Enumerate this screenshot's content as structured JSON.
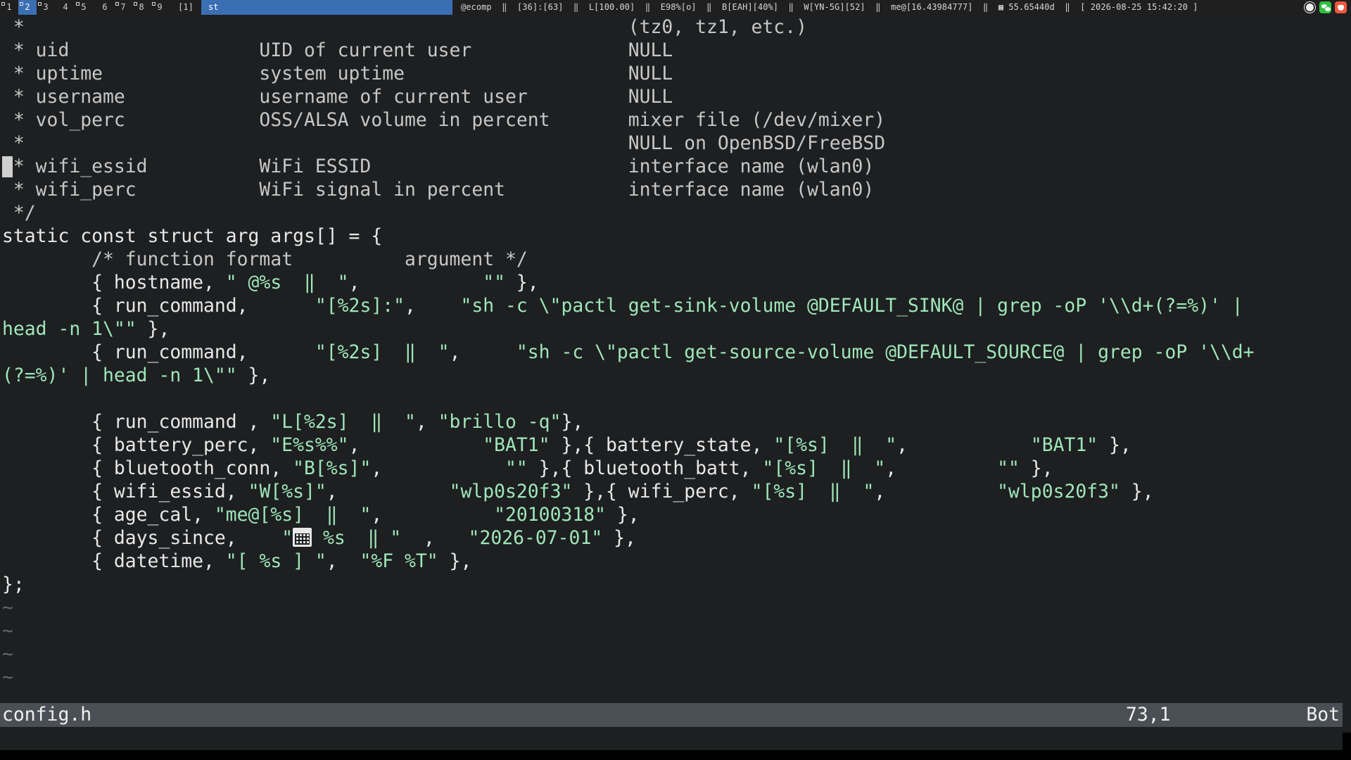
{
  "topbar": {
    "tags": [
      "1",
      "2",
      "3",
      "4",
      "5",
      "6",
      "7",
      "8",
      "9"
    ],
    "selected_tag": "2",
    "layout": "[1]",
    "window_title": "st",
    "status_text": "@ecomp  ‖  [36]:[63]  ‖  L[100.00]  ‖  E98%[o]  ‖  B[EAH][40%]  ‖  W[YN-5G][52]  ‖  me@[16.43984777]  ‖  ▦ 55.65440d  ‖  [ 2026-08-25 15:42:20 ]",
    "tray_icons": [
      "brightness-icon",
      "wechat-icon",
      "app-icon"
    ]
  },
  "editor": {
    "lines": [
      [
        {
          "t": " *                                                      (tz0, tz1, etc.)",
          "c": "com"
        }
      ],
      [
        {
          "t": " * uid                 UID of current user              NULL",
          "c": "com"
        }
      ],
      [
        {
          "t": " * uptime              system uptime                    NULL",
          "c": "com"
        }
      ],
      [
        {
          "t": " * username            username of current user         NULL",
          "c": "com"
        }
      ],
      [
        {
          "t": " * vol_perc            OSS/ALSA volume in percent       mixer file (/dev/mixer)",
          "c": "com"
        }
      ],
      [
        {
          "t": " *                                                      NULL on OpenBSD/FreeBSD",
          "c": "com"
        }
      ],
      [
        {
          "t": " * wifi_essid          WiFi ESSID                       interface name (wlan0)",
          "c": "com"
        }
      ],
      [
        {
          "t": " * wifi_perc           WiFi signal in percent           interface name (wlan0)",
          "c": "com"
        }
      ],
      [
        {
          "t": " */",
          "c": "com"
        }
      ],
      [
        {
          "t": "static const struct arg args[] = {",
          "c": "n"
        }
      ],
      [
        {
          "t": "        /* function format          argument */",
          "c": "com"
        }
      ],
      [
        {
          "t": "        { hostname, ",
          "c": "n"
        },
        {
          "t": "\" @%s  ‖  \"",
          "c": "str"
        },
        {
          "t": ",           ",
          "c": "n"
        },
        {
          "t": "\"\"",
          "c": "str"
        },
        {
          "t": " },",
          "c": "n"
        }
      ],
      [
        {
          "t": "        { run_command,      ",
          "c": "n"
        },
        {
          "t": "\"[%2s]:\"",
          "c": "str"
        },
        {
          "t": ",    ",
          "c": "n"
        },
        {
          "t": "\"sh -c \\\"pactl get-sink-volume @DEFAULT_SINK@ | grep -oP '\\\\d+(?=%)' |",
          "c": "str"
        }
      ],
      [
        {
          "t": "head -n 1\\\"\"",
          "c": "str"
        },
        {
          "t": " },",
          "c": "n"
        }
      ],
      [
        {
          "t": "        { run_command,      ",
          "c": "n"
        },
        {
          "t": "\"[%2s]  ‖  \"",
          "c": "str"
        },
        {
          "t": ",     ",
          "c": "n"
        },
        {
          "t": "\"sh -c \\\"pactl get-source-volume @DEFAULT_SOURCE@ | grep -oP '\\\\d+",
          "c": "str"
        }
      ],
      [
        {
          "t": "(?=%)' | head -n 1\\\"\"",
          "c": "str"
        },
        {
          "t": " },",
          "c": "n"
        }
      ],
      [
        {
          "t": "",
          "c": "n"
        }
      ],
      [
        {
          "t": "        { run_command , ",
          "c": "n"
        },
        {
          "t": "\"L[%2s]  ‖  \"",
          "c": "str"
        },
        {
          "t": ", ",
          "c": "n"
        },
        {
          "t": "\"brillo -q\"",
          "c": "str"
        },
        {
          "t": "},",
          "c": "n"
        }
      ],
      [
        {
          "t": "        { battery_perc, ",
          "c": "n"
        },
        {
          "t": "\"E%s%%\"",
          "c": "str"
        },
        {
          "t": ",           ",
          "c": "n"
        },
        {
          "t": "\"BAT1\"",
          "c": "str"
        },
        {
          "t": " },{ battery_state, ",
          "c": "n"
        },
        {
          "t": "\"[%s]  ‖  \"",
          "c": "str"
        },
        {
          "t": ",           ",
          "c": "n"
        },
        {
          "t": "\"BAT1\"",
          "c": "str"
        },
        {
          "t": " },",
          "c": "n"
        }
      ],
      [
        {
          "t": "        { bluetooth_conn, ",
          "c": "n"
        },
        {
          "t": "\"B[%s]\"",
          "c": "str"
        },
        {
          "t": ",           ",
          "c": "n"
        },
        {
          "t": "\"\"",
          "c": "str"
        },
        {
          "t": " },{ bluetooth_batt, ",
          "c": "n"
        },
        {
          "t": "\"[%s]  ‖  \"",
          "c": "str"
        },
        {
          "t": ",         ",
          "c": "n"
        },
        {
          "t": "\"\"",
          "c": "str"
        },
        {
          "t": " },",
          "c": "n"
        }
      ],
      [
        {
          "t": "        { wifi_essid, ",
          "c": "n"
        },
        {
          "t": "\"W[%s]\"",
          "c": "str"
        },
        {
          "t": ",          ",
          "c": "n"
        },
        {
          "t": "\"wlp0s20f3\"",
          "c": "str"
        },
        {
          "t": " },{ wifi_perc, ",
          "c": "n"
        },
        {
          "t": "\"[%s]  ‖  \"",
          "c": "str"
        },
        {
          "t": ",          ",
          "c": "n"
        },
        {
          "t": "\"wlp0s20f3\"",
          "c": "str"
        },
        {
          "t": " },",
          "c": "n"
        }
      ],
      [
        {
          "t": "        { age_cal, ",
          "c": "n"
        },
        {
          "t": "\"me@[%s]  ‖  \"",
          "c": "str"
        },
        {
          "t": ",          ",
          "c": "n"
        },
        {
          "t": "\"20100318\"",
          "c": "str"
        },
        {
          "t": " },",
          "c": "n"
        }
      ],
      [
        {
          "t": "        { days_since,    ",
          "c": "n"
        },
        {
          "t": "\"",
          "c": "str"
        },
        {
          "t": "ICON",
          "c": "cal"
        },
        {
          "t": " %s  ‖ \"",
          "c": "str"
        },
        {
          "t": "  ,   ",
          "c": "n"
        },
        {
          "t": "\"2026-07-01\"",
          "c": "str"
        },
        {
          "t": " },",
          "c": "n"
        }
      ],
      [
        {
          "t": "        { datetime, ",
          "c": "n"
        },
        {
          "t": "\"[ %s ] \"",
          "c": "str"
        },
        {
          "t": ",  ",
          "c": "n"
        },
        {
          "t": "\"%F %T\"",
          "c": "str"
        },
        {
          "t": " },",
          "c": "n"
        }
      ],
      [
        {
          "t": "};",
          "c": "n"
        }
      ],
      [
        {
          "t": "~",
          "c": "tilde"
        }
      ],
      [
        {
          "t": "~",
          "c": "tilde"
        }
      ],
      [
        {
          "t": "~",
          "c": "tilde"
        }
      ],
      [
        {
          "t": "~",
          "c": "tilde"
        }
      ]
    ]
  },
  "vim_status": {
    "filename": "config.h",
    "position": "73,1",
    "scroll": "Bot"
  },
  "colors": {
    "string": "#9fe6b8",
    "comment": "#c7c7c7",
    "normal": "#e8e8e8",
    "background": "#1d1f21",
    "accent": "#3b6fb4"
  }
}
